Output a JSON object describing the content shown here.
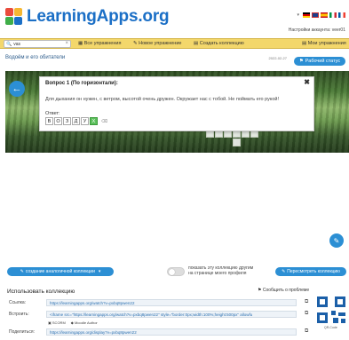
{
  "header": {
    "logo_text": "LearningApps.org",
    "account_label": "Настройки аккаунта: veer01"
  },
  "toolbar": {
    "search_value": "vas",
    "all_exercises": "Все упражнения",
    "new_exercise": "Новое упражнение",
    "create_collection": "Создать коллекцию",
    "my_exercises": "Мои упражнения"
  },
  "page": {
    "title": "Водоём и его обитатели",
    "date": "2022-02-27",
    "status_button": "Рабочий статус"
  },
  "dialog": {
    "question_title": "Вопрос 1 (По горизонтали):",
    "question_text": "Для дыхания он нужен, с ветром, высотой очень дружен. Окружает нас с тобой. Не поймать его рукой!",
    "answer_label": "Ответ:",
    "letters": [
      "В",
      "О",
      "З",
      "Д",
      "У",
      "Х"
    ],
    "clear_icon": "eraser-icon",
    "close_icon": "close-icon"
  },
  "actions": {
    "create_collection": "создание аналогичной коллекции",
    "toggle_text_line1": "показать эту коллекцию другим",
    "toggle_text_line2": "на странице моего профиля",
    "review_collection": "Пересмотреть коллекцию"
  },
  "share": {
    "title": "Использовать коллекцию",
    "report": "Сообщить о проблеме",
    "link_label": "Ссылка:",
    "link_value": "https://learningapps.org/watch?v=pxbq8pwen22",
    "embed_label": "Встроить:",
    "embed_value": "<iframe src=\"https://learningapps.org/watch?v=pxbq8pwen22\" style=\"border:0px;width:100%;height:500px\" allowfu",
    "embed_opt1": "SCORM",
    "embed_opt2": "Moodle Author",
    "share_label": "Поделиться:",
    "share_value": "https://learningapps.org/display?v=pxbq8pwen22",
    "qr_label": "QR-Code"
  },
  "colors": {
    "accent": "#2c8fd4",
    "toolbar": "#f3d76b",
    "correct": "#5cc05c"
  }
}
